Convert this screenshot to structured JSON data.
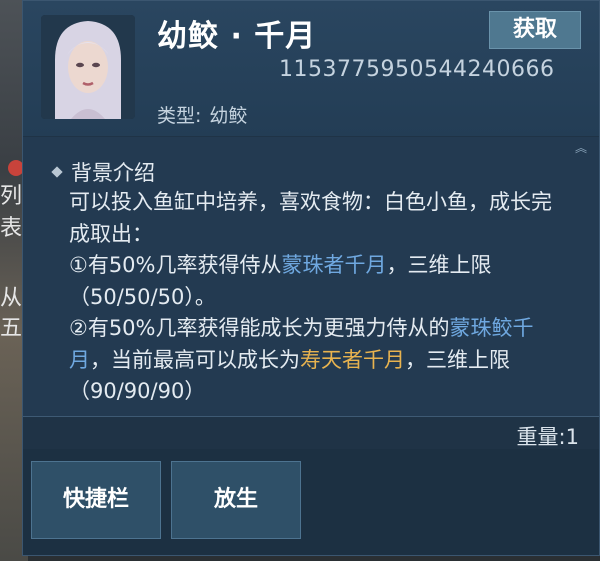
{
  "item": {
    "name": "幼鲛 · 千月",
    "id": "1153775950544240666",
    "type_label": "类型:",
    "type_value": "幼鲛",
    "portrait_icon": "character-portrait"
  },
  "actions": {
    "obtain_label": "获取",
    "quickbar_label": "快捷栏",
    "release_label": "放生"
  },
  "description": {
    "section_title": "背景介绍",
    "line1": "可以投入鱼缸中培养，喜欢食物：白色小鱼，成长完成取出：",
    "opt1_prefix": "①有50%几率获得侍从",
    "opt1_highlight": "蒙珠者千月",
    "opt1_suffix": "，三维上限（50/50/50）。",
    "opt2_prefix": "②有50%几率获得能成长为更强力侍从的",
    "opt2_highlight": "蒙珠鲛千月",
    "opt2_mid": "，当前最高可以成长为",
    "opt2_highlight2": "寿天者千月",
    "opt2_suffix": "，三维上限（90/90/90）"
  },
  "weight": {
    "label": "重量:",
    "value": "1"
  },
  "background_fragments": [
    "列",
    "表",
    "从",
    "五"
  ],
  "colors": {
    "highlight_blue": "#6fa8e0",
    "highlight_gold": "#e8b34f",
    "panel_bg": "#1f3346"
  }
}
